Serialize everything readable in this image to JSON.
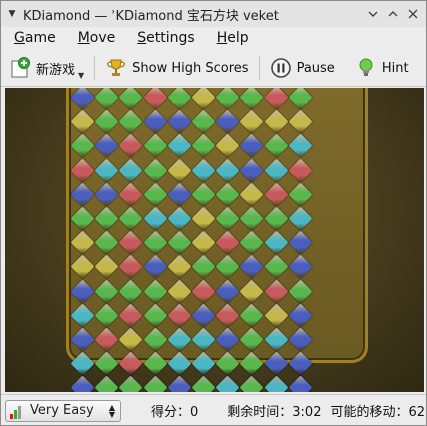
{
  "window": {
    "title": "KDiamond  —  ʾKDiamond 宝石方块 veket"
  },
  "menubar": {
    "items": [
      {
        "label": "Game",
        "mnemonic": "G",
        "rest": "ame"
      },
      {
        "label": "Move",
        "mnemonic": "M",
        "rest": "ove"
      },
      {
        "label": "Settings",
        "mnemonic": "S",
        "rest": "ettings"
      },
      {
        "label": "Help",
        "mnemonic": "H",
        "rest": "elp"
      }
    ]
  },
  "toolbar": {
    "new_game_label": "新游戏",
    "high_scores_label": "Show High Scores",
    "pause_label": "Pause",
    "hint_label": "Hint"
  },
  "board": {
    "colors": {
      "b": "#4a5ec0",
      "g": "#58b84e",
      "r": "#c85a5e",
      "y": "#c4b84a",
      "c": "#4ab8c4",
      "x": "#5a6a8a"
    },
    "rows": [
      "bggrgyggrg",
      "yggbbgbyyy",
      "gbrgcgybgc",
      "rccgyccbcr",
      "bbrgbggyrg",
      "gggccygggc",
      "ygrggyrgcb",
      "yyrbyggbgb",
      "bgggyrbyrg",
      "cgrgrbrgyb",
      "brygccbgcb",
      "cgrgccggbb",
      "bgggbgcgcb"
    ]
  },
  "status": {
    "difficulty": "Very Easy",
    "score_label": "得分：0",
    "time_label": "剩余时间：3:02",
    "moves_label": "可能的移动：62"
  }
}
